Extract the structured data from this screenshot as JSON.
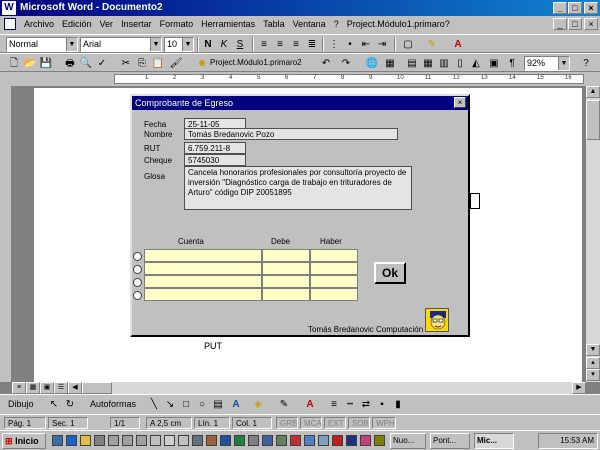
{
  "window": {
    "title": "Microsoft Word - Documento2"
  },
  "menu": [
    "Archivo",
    "Edición",
    "Ver",
    "Insertar",
    "Formato",
    "Herramientas",
    "Tabla",
    "Ventana",
    "?",
    "Project.Módulo1.primaro?"
  ],
  "format_toolbar": {
    "style": "Normal",
    "font": "Arial",
    "size": "10",
    "bold": "N",
    "italic": "K",
    "underline": "S"
  },
  "standard_toolbar": {
    "macro_label": "Project.Módulo1.primaro2",
    "zoom": "92%"
  },
  "ruler_marks": [
    "1",
    "2",
    "3",
    "4",
    "5",
    "6",
    "7",
    "8",
    "9",
    "10",
    "11",
    "12",
    "13",
    "14",
    "15",
    "16"
  ],
  "dialog": {
    "title": "Comprobante de Egreso",
    "close": "×",
    "fields": [
      {
        "label": "Fecha",
        "value": "25-11-05"
      },
      {
        "label": "Nombre",
        "value": "Tomás Bredanovic Pozo"
      },
      {
        "label": "RUT",
        "value": "6.759.211-8"
      },
      {
        "label": "Cheque",
        "value": "5745030"
      }
    ],
    "glosa_label": "Glosa",
    "glosa_value": "Cancela honorarios profesionales por consultoría proyecto de inversión \"Diagnóstico carga de trabajo en trituradores de Arturo\" código DIP 20051895",
    "columns": {
      "cuenta": "Cuenta",
      "debe": "Debe",
      "haber": "Haber"
    },
    "rows": 4,
    "ok": "Ok",
    "credit": "Tomás Bredanovic Computación"
  },
  "document_text": "PUT",
  "drawing_toolbar": {
    "draw": "Dibujo",
    "autoshapes": "Autoformas"
  },
  "status": {
    "page": "Pág. 1",
    "section": "Sec. 1",
    "pages": "1/1",
    "position": "A 2,5 cm",
    "line": "Lín. 1",
    "column": "Col. 1",
    "modes": [
      "GRB",
      "MCA",
      "EXT",
      "SOB",
      "WPH"
    ]
  },
  "taskbar": {
    "start": "Inicio",
    "tasks": [
      "Nuo...",
      "Pont...",
      "Mic..."
    ],
    "clock": "15:53 AM"
  },
  "colors": {
    "title_start": "#000080",
    "title_end": "#1084d0",
    "cell_fill": "#ffffc8",
    "chrome": "#c0c0c0"
  }
}
